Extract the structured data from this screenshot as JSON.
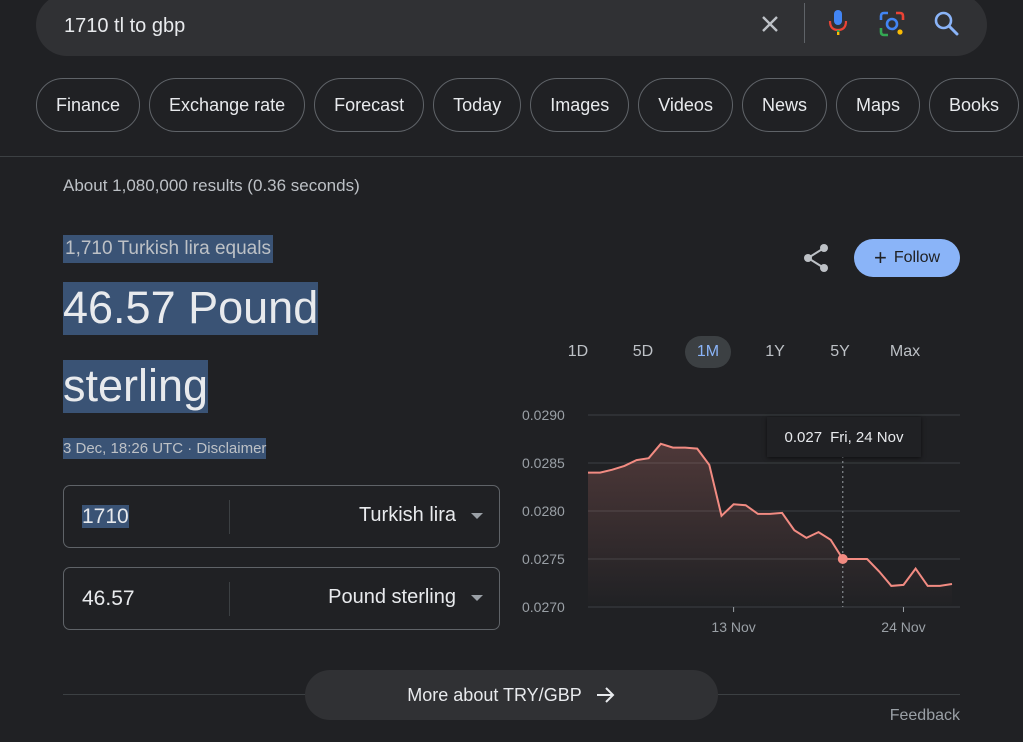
{
  "search": {
    "query": "1710 tl to gbp",
    "icons": [
      "clear-icon",
      "mic-icon",
      "lens-icon",
      "search-icon"
    ]
  },
  "chips": [
    "Finance",
    "Exchange rate",
    "Forecast",
    "Today",
    "Images",
    "Videos",
    "News",
    "Maps",
    "Books"
  ],
  "results_count": "About 1,080,000 results (0.36 seconds)",
  "conversion": {
    "lead": "1,710 Turkish lira equals",
    "result_line1": "46.57 Pound",
    "result_line2": "sterling",
    "timestamp": "3 Dec, 18:26 UTC",
    "separator": " · ",
    "disclaimer": "Disclaimer",
    "from_amount": "1710",
    "from_currency": "Turkish lira",
    "to_amount": "46.57",
    "to_currency": "Pound sterling"
  },
  "actions": {
    "follow_label": "Follow",
    "follow_plus": "+"
  },
  "range_tabs": [
    "1D",
    "5D",
    "1M",
    "1Y",
    "5Y",
    "Max"
  ],
  "active_range": "1M",
  "tooltip": {
    "value": "0.027",
    "date": "Fri, 24 Nov"
  },
  "colors": {
    "accent": "#8ab4f8",
    "line": "#f28b82",
    "background": "#202124"
  },
  "chart_data": {
    "type": "line",
    "xlabel": "",
    "ylabel": "",
    "ylim": [
      0.027,
      0.029
    ],
    "yticks": [
      "0.0290",
      "0.0285",
      "0.0280",
      "0.0275",
      "0.0270"
    ],
    "xticks": [
      {
        "label": "13 Nov",
        "index": 12
      },
      {
        "label": "24 Nov",
        "index": 26
      }
    ],
    "grid": true,
    "values": [
      0.0284,
      0.0284,
      0.02843,
      0.02847,
      0.02853,
      0.02855,
      0.0287,
      0.02866,
      0.02866,
      0.02865,
      0.02848,
      0.02795,
      0.02807,
      0.02806,
      0.02797,
      0.02797,
      0.02798,
      0.0278,
      0.02772,
      0.02778,
      0.0277,
      0.0275,
      0.0275,
      0.0275,
      0.02737,
      0.02722,
      0.02723,
      0.0274,
      0.02722,
      0.02722,
      0.02724
    ],
    "highlight_index": 21
  },
  "footer": {
    "more_label": "More about TRY/GBP",
    "feedback": "Feedback"
  }
}
